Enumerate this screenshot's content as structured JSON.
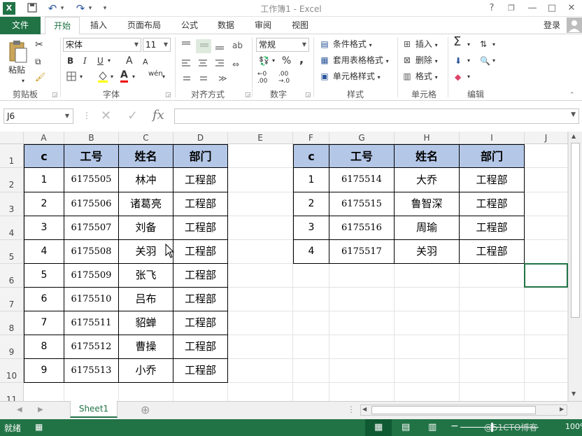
{
  "window": {
    "title": "工作簿1 - Excel",
    "help": "?",
    "min": "—",
    "restore": "□",
    "close": "✕",
    "restore2": "❐"
  },
  "quick_access": {
    "excel_icon": "X",
    "save": "💾",
    "undo": "↶",
    "undo_dd": "▾",
    "redo": "↷",
    "redo_dd": "▾",
    "more": "▾"
  },
  "tabs": [
    "文件",
    "开始",
    "插入",
    "页面布局",
    "公式",
    "数据",
    "审阅",
    "视图"
  ],
  "login": "登录",
  "ribbon": {
    "clipboard": {
      "paste": "粘贴",
      "label": "剪贴板"
    },
    "font": {
      "name": "宋体",
      "size": "11",
      "bold": "B",
      "italic": "I",
      "underline": "U",
      "grow": "A",
      "shrink": "A",
      "wen": "wén",
      "label": "字体"
    },
    "align": {
      "label": "对齐方式"
    },
    "number": {
      "format": "常规",
      "percent": "%",
      "comma": ",",
      "label": "数字"
    },
    "styles": {
      "cond": "条件格式",
      "table": "套用表格格式",
      "cell": "单元格样式",
      "label": "样式"
    },
    "cells": {
      "insert": "插入",
      "delete": "删除",
      "format": "格式",
      "label": "单元格"
    },
    "edit": {
      "label": "编辑"
    }
  },
  "formula_bar": {
    "name_box": "J6",
    "fx": "fx",
    "cancel": "✕",
    "enter": "✓"
  },
  "columns": [
    "A",
    "B",
    "C",
    "D",
    "E",
    "F",
    "G",
    "H",
    "I",
    "J"
  ],
  "rows": [
    "1",
    "2",
    "3",
    "4",
    "5",
    "6",
    "7",
    "8",
    "9",
    "10",
    "11"
  ],
  "table1": {
    "headers": [
      "c",
      "工号",
      "姓名",
      "部门"
    ],
    "rows": [
      [
        "1",
        "6175505",
        "林冲",
        "工程部"
      ],
      [
        "2",
        "6175506",
        "诸葛亮",
        "工程部"
      ],
      [
        "3",
        "6175507",
        "刘备",
        "工程部"
      ],
      [
        "4",
        "6175508",
        "关羽",
        "工程部"
      ],
      [
        "5",
        "6175509",
        "张飞",
        "工程部"
      ],
      [
        "6",
        "6175510",
        "吕布",
        "工程部"
      ],
      [
        "7",
        "6175511",
        "貂蝉",
        "工程部"
      ],
      [
        "8",
        "6175512",
        "曹操",
        "工程部"
      ],
      [
        "9",
        "6175513",
        "小乔",
        "工程部"
      ]
    ]
  },
  "table2": {
    "headers": [
      "c",
      "工号",
      "姓名",
      "部门"
    ],
    "rows": [
      [
        "1",
        "6175514",
        "大乔",
        "工程部"
      ],
      [
        "2",
        "6175515",
        "鲁智深",
        "工程部"
      ],
      [
        "3",
        "6175516",
        "周瑜",
        "工程部"
      ],
      [
        "4",
        "6175517",
        "关羽",
        "工程部"
      ]
    ]
  },
  "sheet_tab": "Sheet1",
  "add_sheet": "⊕",
  "status": {
    "ready": "就绪",
    "zoom": "100%",
    "watermark": "@51CTO博客"
  },
  "colors": {
    "accent": "#217346",
    "header_fill": "#b4c7e7"
  }
}
